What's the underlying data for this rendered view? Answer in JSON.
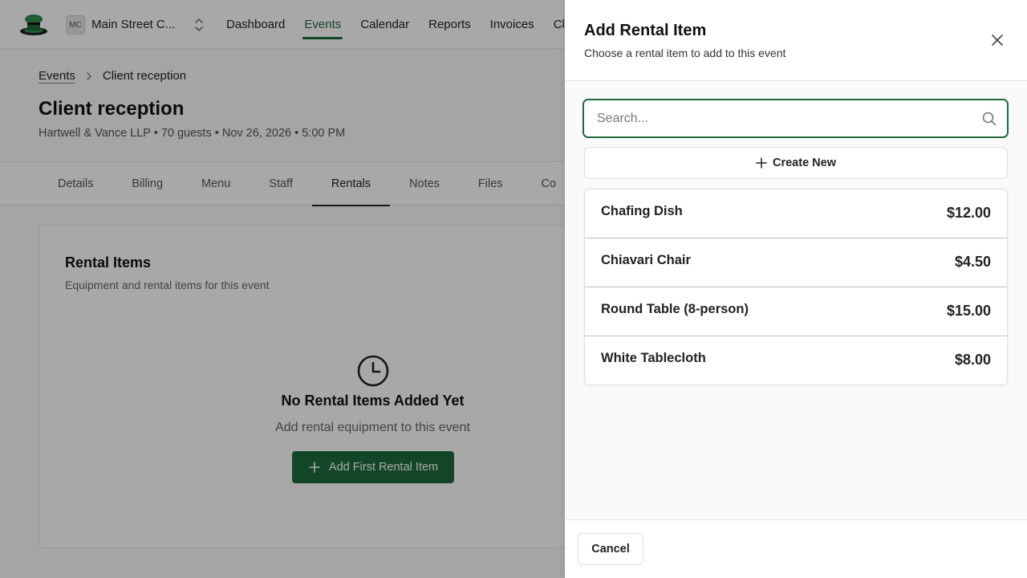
{
  "app": {
    "org_initials": "MC",
    "org_name": "Main Street C...",
    "nav": [
      "Dashboard",
      "Events",
      "Calendar",
      "Reports",
      "Invoices",
      "Cl"
    ],
    "active_nav": "Events"
  },
  "breadcrumb": {
    "parent": "Events",
    "current": "Client reception"
  },
  "event": {
    "title": "Client reception",
    "subtitle": "Hartwell & Vance LLP • 70 guests • Nov 26, 2026 • 5:00 PM"
  },
  "tabs": [
    "Details",
    "Billing",
    "Menu",
    "Staff",
    "Rentals",
    "Notes",
    "Files",
    "Co"
  ],
  "active_tab": "Rentals",
  "rental_card": {
    "title": "Rental Items",
    "subtitle": "Equipment and rental items for this event",
    "empty_title": "No Rental Items Added Yet",
    "empty_subtitle": "Add rental equipment to this event",
    "add_first_label": "Add First Rental Item"
  },
  "drawer": {
    "title": "Add Rental Item",
    "subtitle": "Choose a rental item to add to this event",
    "search_placeholder": "Search...",
    "search_value": "",
    "create_label": "Create New",
    "items": [
      {
        "name": "Chafing Dish",
        "price": "$12.00"
      },
      {
        "name": "Chiavari Chair",
        "price": "$4.50"
      },
      {
        "name": "Round Table (8-person)",
        "price": "$15.00"
      },
      {
        "name": "White Tablecloth",
        "price": "$8.00"
      }
    ],
    "cancel_label": "Cancel"
  },
  "colors": {
    "accent": "#1d6b3a",
    "overlay": "rgba(0,0,0,0.34)"
  },
  "icons": {
    "logo": "chef-hat-logo",
    "org_switch": "chevrons-up-down-icon",
    "breadcrumb_sep": "chevron-right-icon",
    "empty": "clock-icon",
    "add": "plus-icon",
    "close": "close-icon",
    "search": "search-icon"
  }
}
